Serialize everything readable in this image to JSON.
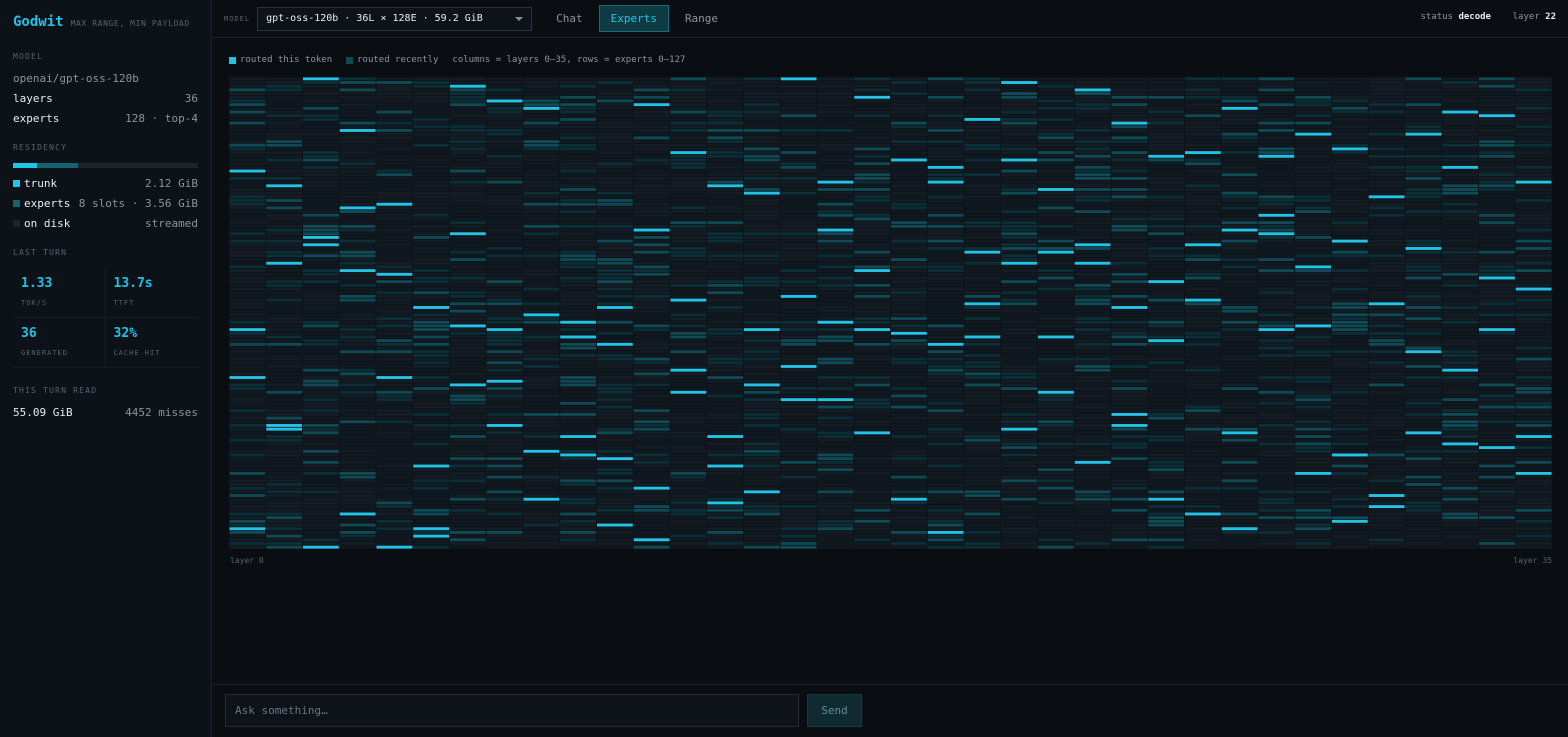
{
  "brand": {
    "name": "Godwit",
    "tagline": "MAX RANGE, MIN PAYLOAD"
  },
  "sidebar": {
    "model_section": {
      "label": "MODEL",
      "name": "openai/gpt-oss-120b",
      "rows": [
        {
          "key": "layers",
          "value": "36"
        },
        {
          "key": "experts",
          "value": "128 · top-4"
        }
      ]
    },
    "residency": {
      "label": "RESIDENCY",
      "bar": {
        "trunk_fraction": 0.13,
        "experts_fraction": 0.22
      },
      "rows": [
        {
          "key": "trunk",
          "value": "2.12 GiB",
          "color": "#22c3e6"
        },
        {
          "key": "experts",
          "sub": "8 slots",
          "value": "3.56 GiB",
          "color": "#13636f"
        },
        {
          "key": "on disk",
          "value": "streamed",
          "color": "#1b242d"
        }
      ]
    },
    "last_turn": {
      "label": "LAST TURN",
      "stats": [
        {
          "value": "1.33",
          "label": "TOK/S"
        },
        {
          "value": "13.7s",
          "label": "TTFT"
        },
        {
          "value": "36",
          "label": "GENERATED"
        },
        {
          "value": "32%",
          "label": "CACHE HIT"
        }
      ]
    },
    "turn_read": {
      "label": "THIS TURN READ",
      "amount": "55.09 GiB",
      "misses": "4452 misses"
    }
  },
  "topbar": {
    "model_label": "MODEL",
    "model_select": "gpt-oss-120b · 36L × 128E · 59.2 GiB",
    "tabs": [
      {
        "label": "Chat",
        "active": false
      },
      {
        "label": "Experts",
        "active": true
      },
      {
        "label": "Range",
        "active": false
      }
    ],
    "status_label": "status",
    "status_value": "decode",
    "layer_label": "layer",
    "layer_value": "22"
  },
  "legend": {
    "routed_token": "routed this token",
    "routed_recent": "routed recently",
    "description": "columns = layers 0–35, rows = experts 0–127"
  },
  "axis": {
    "left": "layer 0",
    "right": "layer 35"
  },
  "colors": {
    "accent": "#22c3e6",
    "recent": "#0f4a55",
    "cell_dark": "#141c24",
    "cell_base": "#101820"
  },
  "chart_data": {
    "type": "heatmap",
    "columns": 36,
    "rows": 128,
    "column_axis": "layers 0–35",
    "row_axis": "experts 0–127",
    "routed_this_token": [
      [
        25,
        68,
        81,
        122
      ],
      [
        29,
        50,
        94,
        95
      ],
      [
        0,
        43,
        45,
        127
      ],
      [
        14,
        35,
        52,
        118
      ],
      [
        34,
        53,
        81,
        127
      ],
      [
        62,
        105,
        122,
        124
      ],
      [
        2,
        42,
        67,
        83
      ],
      [
        6,
        68,
        82,
        94
      ],
      [
        8,
        64,
        101,
        114
      ],
      [
        66,
        70,
        97,
        102
      ],
      [
        62,
        72,
        103,
        121
      ],
      [
        7,
        41,
        111,
        125
      ],
      [
        20,
        60,
        79,
        85
      ],
      [
        29,
        97,
        105,
        115
      ],
      [
        31,
        68,
        83,
        112
      ],
      [
        0,
        59,
        78,
        87
      ],
      [
        28,
        41,
        66,
        87
      ],
      [
        5,
        52,
        68,
        96
      ],
      [
        22,
        69,
        69,
        114
      ],
      [
        24,
        28,
        72,
        123
      ],
      [
        11,
        47,
        61,
        70
      ],
      [
        1,
        22,
        50,
        95
      ],
      [
        30,
        47,
        70,
        85
      ],
      [
        3,
        45,
        50,
        104
      ],
      [
        12,
        62,
        91,
        94
      ],
      [
        21,
        55,
        71,
        114
      ],
      [
        20,
        45,
        60,
        118
      ],
      [
        8,
        41,
        96,
        122
      ],
      [
        21,
        37,
        42,
        68
      ],
      [
        15,
        51,
        67,
        107
      ],
      [
        19,
        44,
        102,
        120
      ],
      [
        32,
        61,
        113,
        116
      ],
      [
        15,
        46,
        74,
        96
      ],
      [
        9,
        24,
        79,
        99
      ],
      [
        10,
        54,
        68,
        100
      ],
      [
        28,
        57,
        97,
        107
      ]
    ]
  }
}
